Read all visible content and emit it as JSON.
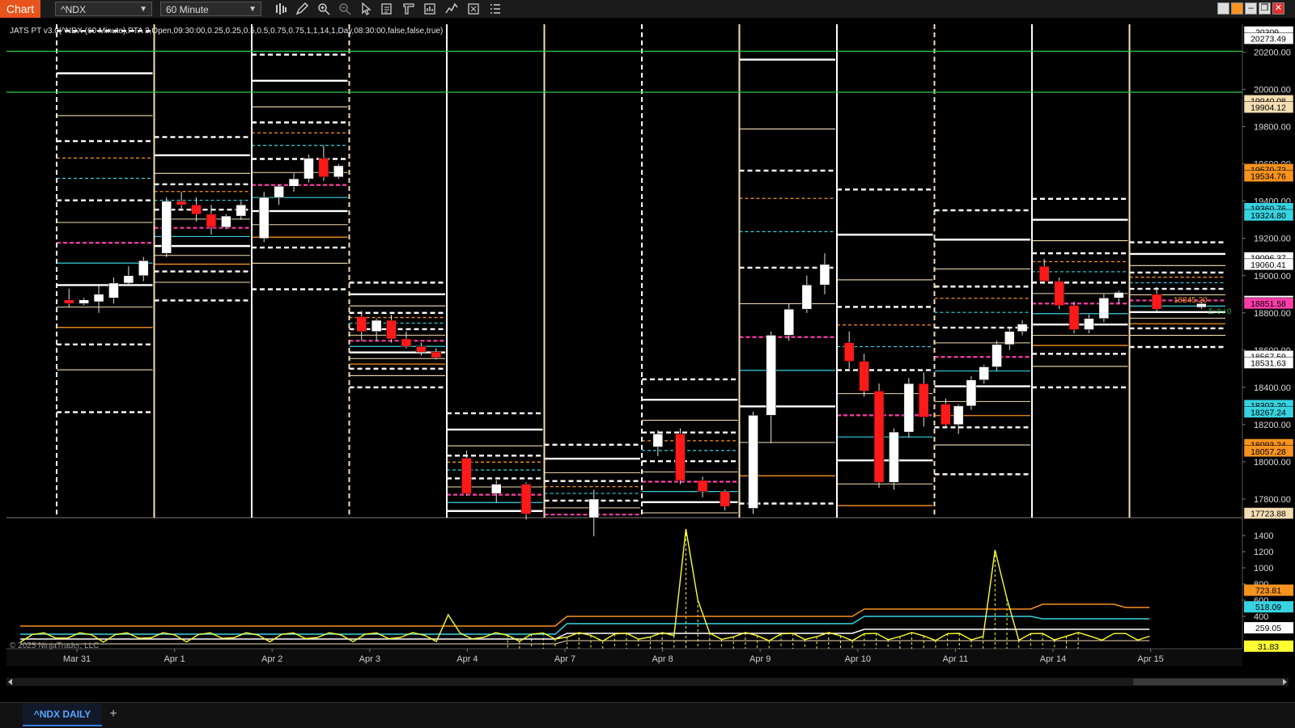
{
  "toolbar": {
    "tab_label": "Chart",
    "instrument": "^NDX",
    "interval": "60 Minute",
    "icons": [
      "bar-type-icon",
      "draw-pencil-icon",
      "zoom-in-icon",
      "zoom-out-icon",
      "pointer-icon",
      "properties-icon",
      "template-icon",
      "data-box-icon",
      "indicators-icon",
      "strategies-icon",
      "list-icon"
    ]
  },
  "chart": {
    "indicator_label": "JATS PT v3.0(^NDX (60 Minute),PTA 3,Open,09:30:00,0.25,0.25,0.5,0.5,0.75,0.75,1,1,14,1,Day,08:30:00,false,false,true)",
    "copyright": "© 2025 NinjaTrader, LLC",
    "last_price_label": "18845.20",
    "pnl_label": "Σ: 0 / 0",
    "date_labels": [
      "Mar 31",
      "Apr 1",
      "Apr 2",
      "Apr 3",
      "Apr 4",
      "Apr 7",
      "Apr 8",
      "Apr 9",
      "Apr 10",
      "Apr 11",
      "Apr 14",
      "Apr 15"
    ]
  },
  "price_axis": {
    "ticks": [
      "20200.00",
      "20000.00",
      "19800.00",
      "19600.00",
      "19400.00",
      "19200.00",
      "19000.00",
      "18800.00",
      "18600.00",
      "18400.00",
      "18200.00",
      "18000.00",
      "17800.00"
    ],
    "badges": [
      {
        "value": "20309.",
        "color": "#ffffff"
      },
      {
        "value": "20273.49",
        "color": "#ffffff"
      },
      {
        "value": "19940.08",
        "color": "#f5deb3"
      },
      {
        "value": "19904.12",
        "color": "#f5deb3"
      },
      {
        "value": "19570.72",
        "color": "#f7931e"
      },
      {
        "value": "19534.76",
        "color": "#f7931e"
      },
      {
        "value": "19360.76",
        "color": "#38d3e0"
      },
      {
        "value": "19324.80",
        "color": "#38d3e0"
      },
      {
        "value": "19096.37",
        "color": "#ffffff"
      },
      {
        "value": "19060.41",
        "color": "#ffffff"
      },
      {
        "value": "18862.22",
        "color": "#ffffff"
      },
      {
        "value": "18851.58",
        "color": "#ff3da8"
      },
      {
        "value": "18567.59",
        "color": "#ffffff"
      },
      {
        "value": "18531.63",
        "color": "#ffffff"
      },
      {
        "value": "18303.20",
        "color": "#38d3e0"
      },
      {
        "value": "18267.24",
        "color": "#38d3e0"
      },
      {
        "value": "18093.24",
        "color": "#f7931e"
      },
      {
        "value": "18057.28",
        "color": "#f7931e"
      },
      {
        "value": "17723.88",
        "color": "#f5deb3"
      }
    ]
  },
  "volume_axis": {
    "ticks": [
      "1400",
      "1200",
      "1000",
      "800",
      "600",
      "400"
    ],
    "badges": [
      {
        "value": "723.81",
        "color": "#f7931e"
      },
      {
        "value": "518.09",
        "color": "#38d3e0"
      },
      {
        "value": "259.05",
        "color": "#ffffff"
      },
      {
        "value": "31.83",
        "color": "#ffff33"
      }
    ]
  },
  "colors": {
    "up": "#ffffff",
    "down": "#ff1a1a",
    "pivot": "#ffffff",
    "orange": "#f7931e",
    "cyan": "#38d3e0",
    "tan": "#f5deb3",
    "magenta": "#ff3da8",
    "green": "#2ecc40",
    "yellow": "#ffff33"
  },
  "chart_data": {
    "type": "candlestick",
    "x": [
      "Mar 31",
      "Apr 1",
      "Apr 2",
      "Apr 3",
      "Apr 4",
      "Apr 7",
      "Apr 8",
      "Apr 9",
      "Apr 10",
      "Apr 11",
      "Apr 14",
      "Apr 15"
    ],
    "ylim": [
      17700,
      20350
    ],
    "grid": false,
    "days": [
      {
        "open": 19700,
        "high": 19780,
        "low": 18870,
        "close": 18880,
        "candles": [
          [
            18870,
            18930,
            18830,
            18850
          ],
          [
            18850,
            18880,
            18840,
            18870
          ],
          [
            18860,
            18950,
            18800,
            18900
          ],
          [
            18880,
            18990,
            18850,
            18960
          ],
          [
            18960,
            19050,
            18950,
            19000
          ],
          [
            19000,
            19100,
            18970,
            19080
          ]
        ]
      },
      {
        "open": 19080,
        "high": 19450,
        "low": 19060,
        "close": 19260,
        "candles": [
          [
            19120,
            19420,
            19100,
            19400
          ],
          [
            19400,
            19450,
            19360,
            19380
          ],
          [
            19380,
            19420,
            19290,
            19330
          ],
          [
            19330,
            19380,
            19220,
            19260
          ],
          [
            19260,
            19330,
            19250,
            19320
          ],
          [
            19320,
            19400,
            19300,
            19380
          ]
        ]
      },
      {
        "open": 19160,
        "high": 19710,
        "low": 19150,
        "close": 19600,
        "candles": [
          [
            19200,
            19450,
            19180,
            19420
          ],
          [
            19420,
            19490,
            19380,
            19480
          ],
          [
            19480,
            19550,
            19450,
            19520
          ],
          [
            19520,
            19650,
            19500,
            19630
          ],
          [
            19630,
            19700,
            19510,
            19530
          ],
          [
            19530,
            19600,
            19520,
            19590
          ]
        ]
      },
      {
        "open": 18780,
        "high": 18810,
        "low": 18560,
        "close": 18580,
        "candles": [
          [
            18780,
            18810,
            18650,
            18700
          ],
          [
            18700,
            18770,
            18650,
            18760
          ],
          [
            18760,
            18790,
            18640,
            18660
          ],
          [
            18660,
            18700,
            18610,
            18620
          ],
          [
            18620,
            18640,
            18570,
            18590
          ],
          [
            18590,
            18610,
            18550,
            18560
          ]
        ]
      },
      {
        "open": 18040,
        "high": 18050,
        "low": 17700,
        "close": 17720,
        "candles": [
          [
            18020,
            18060,
            17820,
            17830
          ],
          [
            17830,
            17900,
            17780,
            17880
          ],
          [
            17880,
            17890,
            17690,
            17720
          ]
        ]
      },
      {
        "open": 17850,
        "high": 17900,
        "low": 17600,
        "close": 17650,
        "candles": [
          [
            17700,
            17850,
            17600,
            17800
          ]
        ]
      },
      {
        "open": 18150,
        "high": 18180,
        "low": 17740,
        "close": 17760,
        "candles": [
          [
            18080,
            18170,
            18030,
            18150
          ],
          [
            18150,
            18180,
            17880,
            17900
          ],
          [
            17900,
            17920,
            17810,
            17840
          ],
          [
            17840,
            17850,
            17740,
            17760
          ]
        ]
      },
      {
        "open": 17800,
        "high": 19230,
        "low": 17740,
        "close": 19040,
        "candles": [
          [
            17750,
            18270,
            17720,
            18250
          ],
          [
            18250,
            18700,
            18100,
            18680
          ],
          [
            18680,
            18850,
            18650,
            18820
          ],
          [
            18820,
            19000,
            18800,
            18950
          ],
          [
            18950,
            19120,
            18900,
            19060
          ]
        ]
      },
      {
        "open": 18640,
        "high": 18750,
        "low": 17780,
        "close": 18220,
        "candles": [
          [
            18640,
            18700,
            18500,
            18540
          ],
          [
            18540,
            18580,
            18350,
            18380
          ],
          [
            18380,
            18420,
            17860,
            17890
          ],
          [
            17890,
            18180,
            17850,
            18160
          ],
          [
            18160,
            18450,
            18130,
            18420
          ],
          [
            18420,
            18480,
            18190,
            18240
          ]
        ]
      },
      {
        "open": 18330,
        "high": 18780,
        "low": 18150,
        "close": 18760,
        "candles": [
          [
            18310,
            18340,
            18180,
            18200
          ],
          [
            18200,
            18310,
            18150,
            18300
          ],
          [
            18300,
            18460,
            18280,
            18440
          ],
          [
            18440,
            18520,
            18420,
            18510
          ],
          [
            18510,
            18650,
            18490,
            18630
          ],
          [
            18630,
            18720,
            18600,
            18700
          ],
          [
            18700,
            18760,
            18680,
            18740
          ]
        ]
      },
      {
        "open": 19060,
        "high": 19090,
        "low": 18640,
        "close": 18820,
        "candles": [
          [
            19050,
            19090,
            18960,
            18970
          ],
          [
            18970,
            18990,
            18820,
            18840
          ],
          [
            18840,
            18860,
            18690,
            18710
          ],
          [
            18710,
            18790,
            18690,
            18770
          ],
          [
            18770,
            18900,
            18750,
            18880
          ],
          [
            18880,
            18920,
            18850,
            18910
          ]
        ]
      },
      {
        "open": 18900,
        "high": 18960,
        "low": 18790,
        "close": 18850,
        "candles": [
          [
            18900,
            18940,
            18800,
            18820
          ],
          [
            18830,
            18860,
            18820,
            18850
          ]
        ]
      }
    ]
  }
}
